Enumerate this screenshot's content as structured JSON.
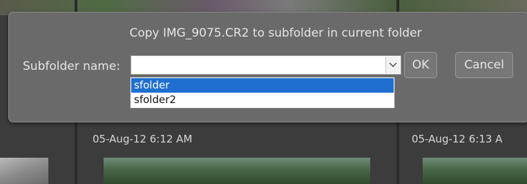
{
  "dialog": {
    "title": "Copy IMG_9075.CR2 to subfolder in current folder",
    "field_label": "Subfolder name:",
    "input_value": "",
    "ok_label": "OK",
    "cancel_label": "Cancel",
    "dropdown_options": [
      "sfolder",
      "sfolder2"
    ],
    "selected_option": "sfolder",
    "highlight_color": "#1f6fd0"
  },
  "background": {
    "thumbnails": [
      {
        "date": "05-Aug-12 6:12 AM"
      },
      {
        "date": "05-Aug-12 6:13 A"
      }
    ]
  }
}
